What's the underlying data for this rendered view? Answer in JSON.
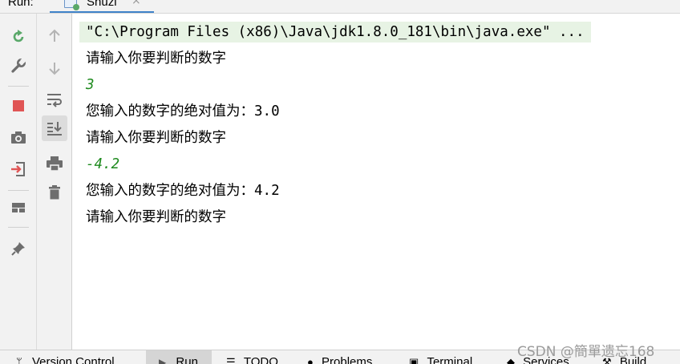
{
  "header": {
    "run_label": "Run:",
    "tab_label": "Shuzi",
    "tab_close": "×"
  },
  "left_toolbar": [
    "rerun-icon",
    "wrench-icon",
    "stop-icon",
    "camera-icon",
    "exit-icon",
    "layout-icon",
    "pin-icon"
  ],
  "mid_toolbar": [
    "up-arrow-icon",
    "down-arrow-icon",
    "soft-wrap-icon",
    "scroll-to-end-icon",
    "print-icon",
    "trash-icon"
  ],
  "console": {
    "command": "\"C:\\Program Files (x86)\\Java\\jdk1.8.0_181\\bin\\java.exe\" ...",
    "lines": [
      {
        "type": "out",
        "text": "请输入你要判断的数字"
      },
      {
        "type": "input",
        "text": "3"
      },
      {
        "type": "out",
        "text": "您输入的数字的绝对值为：3.0"
      },
      {
        "type": "out",
        "text": "请输入你要判断的数字"
      },
      {
        "type": "input",
        "text": "-4.2"
      },
      {
        "type": "out",
        "text": "您输入的数字的绝对值为：4.2"
      },
      {
        "type": "out",
        "text": "请输入你要判断的数字"
      }
    ]
  },
  "status_tabs": {
    "version_control": "Version Control",
    "run": "Run",
    "todo": "TODO",
    "problems": "Problems",
    "terminal": "Terminal",
    "services": "Services",
    "build": "Build"
  },
  "watermark": "CSDN @簡單遗忘168",
  "colors": {
    "input_text": "#1d8a1d",
    "command_bg": "#e7f3e4",
    "stop_red": "#e05555",
    "rerun_green": "#59a869"
  }
}
